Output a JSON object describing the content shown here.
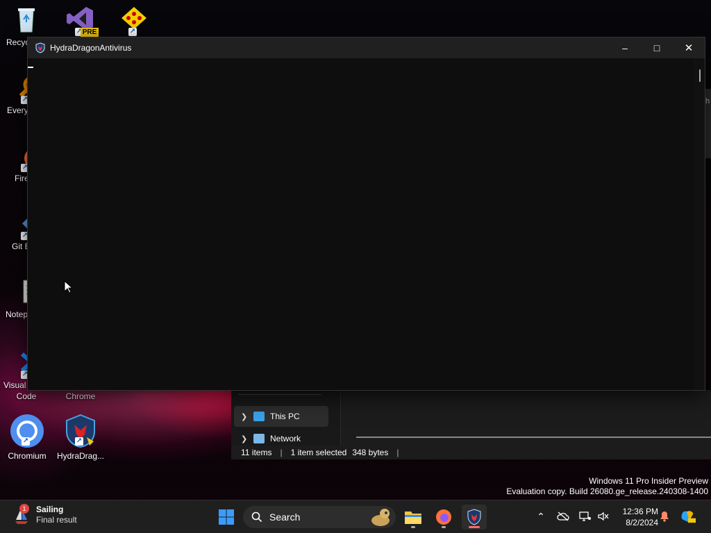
{
  "desktop": {
    "icons": [
      {
        "label": "Recyc",
        "icon": "recycle-bin-icon"
      },
      {
        "label": "",
        "icon": "visual-studio-preview-icon",
        "badge": "PRE"
      },
      {
        "label": "",
        "icon": "pidgin-icon"
      },
      {
        "label": "Every",
        "icon": "everything-search-icon"
      },
      {
        "label": "Fire",
        "icon": "firefox-icon"
      },
      {
        "label": "Git E",
        "icon": "git-extensions-icon"
      },
      {
        "label": "Notep",
        "icon": "notepad-plus-plus-icon"
      },
      {
        "label": "Visual",
        "icon": "vscode-icon"
      },
      {
        "label": "Code",
        "icon": "vscode-label"
      },
      {
        "label": "Chrome",
        "icon": "chrome-label"
      },
      {
        "label": "Chromium",
        "icon": "chromium-icon"
      },
      {
        "label": "HydraDrag...",
        "icon": "hydradragon-icon"
      }
    ]
  },
  "app_window": {
    "title": "HydraDragonAntivirus",
    "minimize": "–",
    "maximize": "□",
    "close": "✕"
  },
  "explorer": {
    "nav_items": [
      {
        "label": "This PC",
        "icon": "computer-icon",
        "selected": true
      },
      {
        "label": "Network",
        "icon": "network-icon",
        "selected": false
      }
    ],
    "status": {
      "items": "11 items",
      "selected": "1 item selected",
      "size": "348 bytes"
    },
    "right_edge_letter": "h"
  },
  "watermark": {
    "line1": "Windows 11 Pro Insider Preview",
    "line2": "Evaluation copy. Build 26080.ge_release.240308-1400"
  },
  "taskbar": {
    "widget": {
      "title": "Sailing",
      "subtitle": "Final result",
      "badge": "1"
    },
    "search_label": "Search",
    "clock": {
      "time": "12:36 PM",
      "date": "8/2/2024"
    },
    "colors": {
      "accent": "#0078d4",
      "taskbar_bg": "#1f1f1f"
    }
  }
}
